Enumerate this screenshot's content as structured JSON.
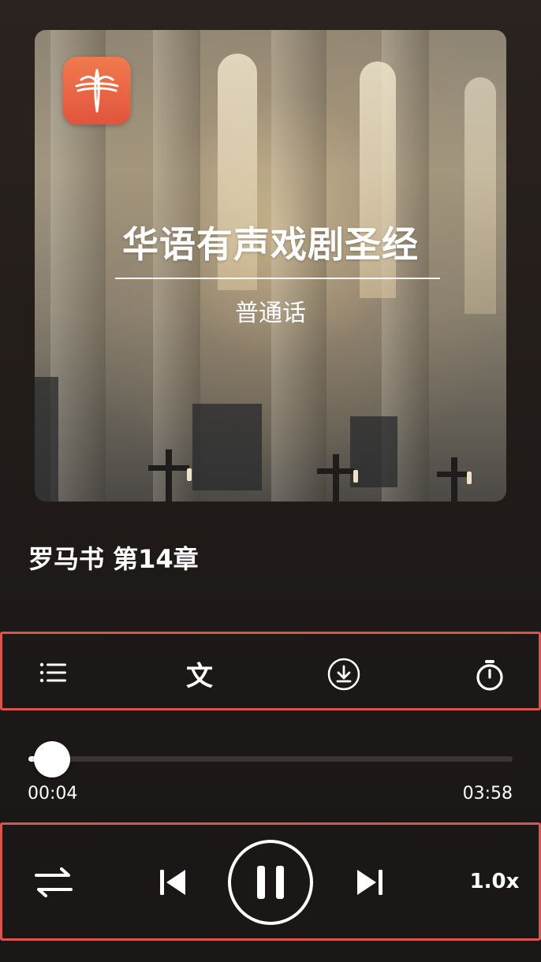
{
  "cover": {
    "title": "华语有声戏剧圣经",
    "subtitle": "普通话"
  },
  "track": {
    "title": "罗马书 第14章"
  },
  "toolbar": {
    "playlist_icon": "list-icon",
    "text_label": "文",
    "download_icon": "download-icon",
    "timer_icon": "stopwatch-icon"
  },
  "progress": {
    "current_time": "00:04",
    "total_time": "03:58",
    "fraction": 0.017
  },
  "controls": {
    "repeat_icon": "repeat-icon",
    "prev_icon": "skip-previous-icon",
    "play_state_icon": "pause-icon",
    "next_icon": "skip-next-icon",
    "speed_label": "1.0x"
  },
  "colors": {
    "highlight_border": "#d9534f",
    "logo": "#e9623f"
  }
}
